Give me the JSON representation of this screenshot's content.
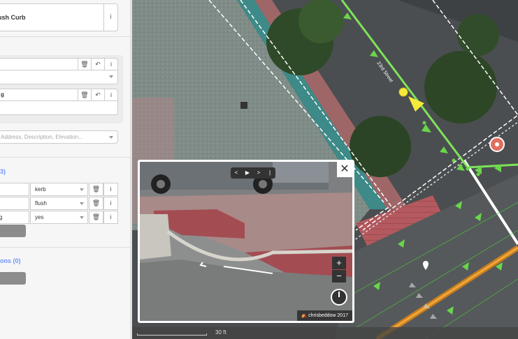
{
  "sidebar": {
    "preset": {
      "name": "ush Curb",
      "info_icon": "info-icon"
    },
    "fields": [
      {
        "label": "",
        "value": ""
      },
      {
        "label": "g",
        "value": ""
      }
    ],
    "search_placeholder": "Address, Description, Elevation...",
    "tags_section_title": "3)",
    "tags": [
      {
        "key": "",
        "value": "kerb"
      },
      {
        "key": "",
        "value": "flush"
      },
      {
        "key": "g",
        "value": "yes"
      }
    ],
    "relations_section_title": "ons (0)"
  },
  "map": {
    "street_label": "23rd Street",
    "scale_label": "30 ft"
  },
  "photo_viewer": {
    "close_label": "✕",
    "controls": [
      "<",
      "▶",
      ">",
      "|"
    ],
    "zoom_in": "+",
    "zoom_out": "−",
    "attribution": "chrisbeddow 2017"
  },
  "colors": {
    "accent": "#7092ff",
    "highlight_line": "#7ee35b",
    "selected_node": "#f6e93b",
    "map_pin": "#e06e5f"
  }
}
